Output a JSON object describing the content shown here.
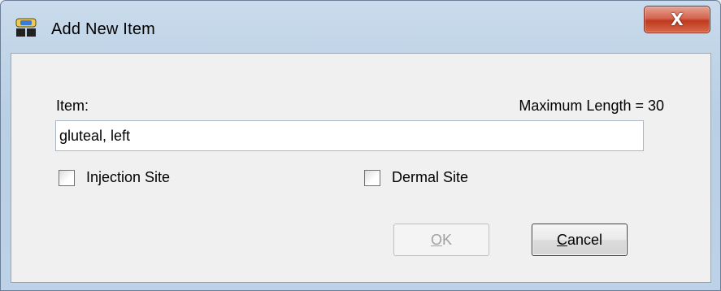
{
  "window": {
    "title": "Add New Item",
    "close_glyph": "X"
  },
  "form": {
    "item_label": "Item:",
    "max_length_label": "Maximum Length = 30",
    "item_value": "gluteal, left",
    "checkboxes": [
      {
        "label": "Injection Site",
        "checked": false
      },
      {
        "label": "Dermal Site",
        "checked": false
      }
    ]
  },
  "buttons": {
    "ok": {
      "mnemonic": "O",
      "rest": "K",
      "enabled": false
    },
    "cancel": {
      "mnemonic": "C",
      "rest": "ancel",
      "enabled": true
    }
  },
  "icons": {
    "title_icon": "app-icon",
    "close_icon": "close-icon"
  },
  "colors": {
    "close_button": "#c0391e",
    "titlebar": "#c9dbec",
    "client_area": "#f0f0f0"
  }
}
